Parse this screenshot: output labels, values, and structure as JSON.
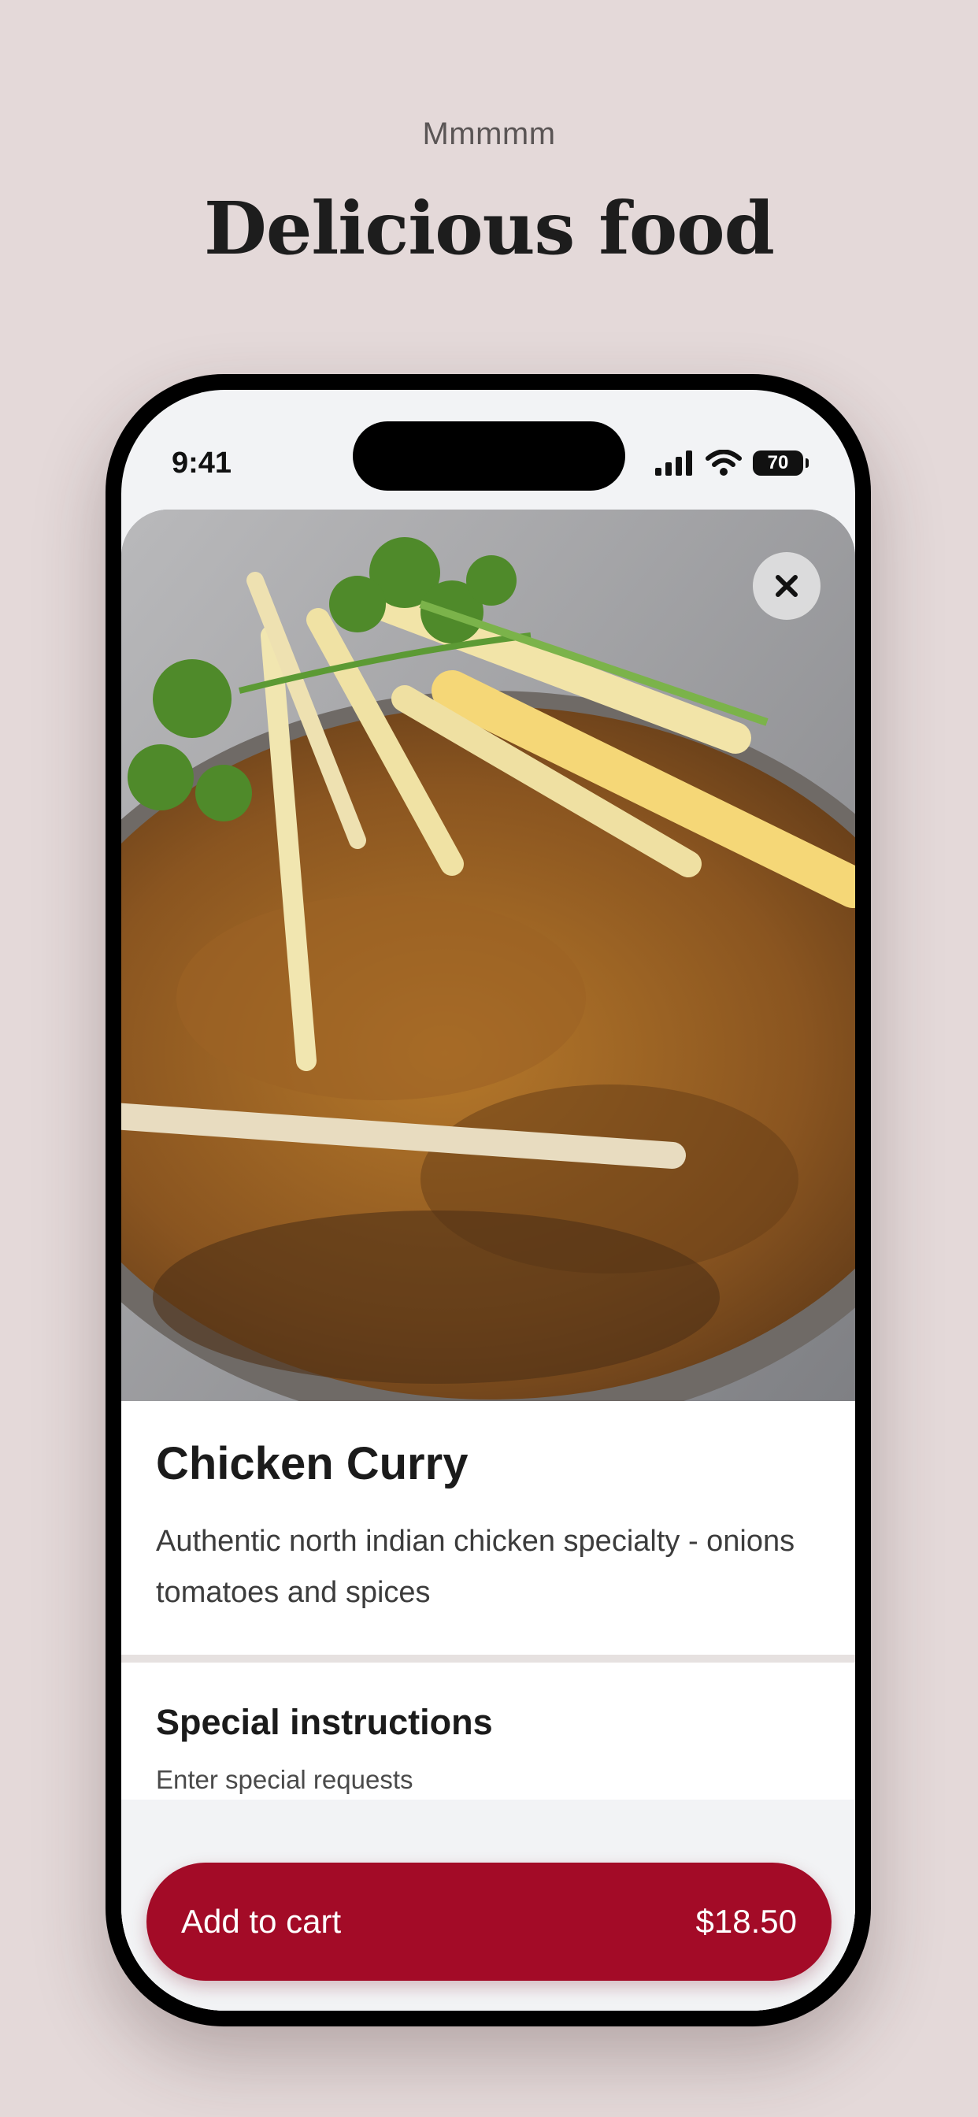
{
  "header": {
    "eyebrow": "Mmmmm",
    "headline": "Delicious food"
  },
  "status_bar": {
    "time": "9:41",
    "battery": "70"
  },
  "item": {
    "image_alt": "Chicken curry garnished with cilantro and ginger strips",
    "title": "Chicken Curry",
    "description": "Authentic north indian chicken specialty - onions tomatoes and spices"
  },
  "special_instructions": {
    "title": "Special instructions",
    "subtitle": "Enter special requests",
    "value": ""
  },
  "cart": {
    "label": "Add to cart",
    "price": "$18.50"
  },
  "colors": {
    "background": "#e4d9d9",
    "accent": "#a30b27",
    "text": "#1c1c1c"
  },
  "icons": [
    "close-icon",
    "signal-icon",
    "wifi-icon",
    "battery-icon"
  ]
}
